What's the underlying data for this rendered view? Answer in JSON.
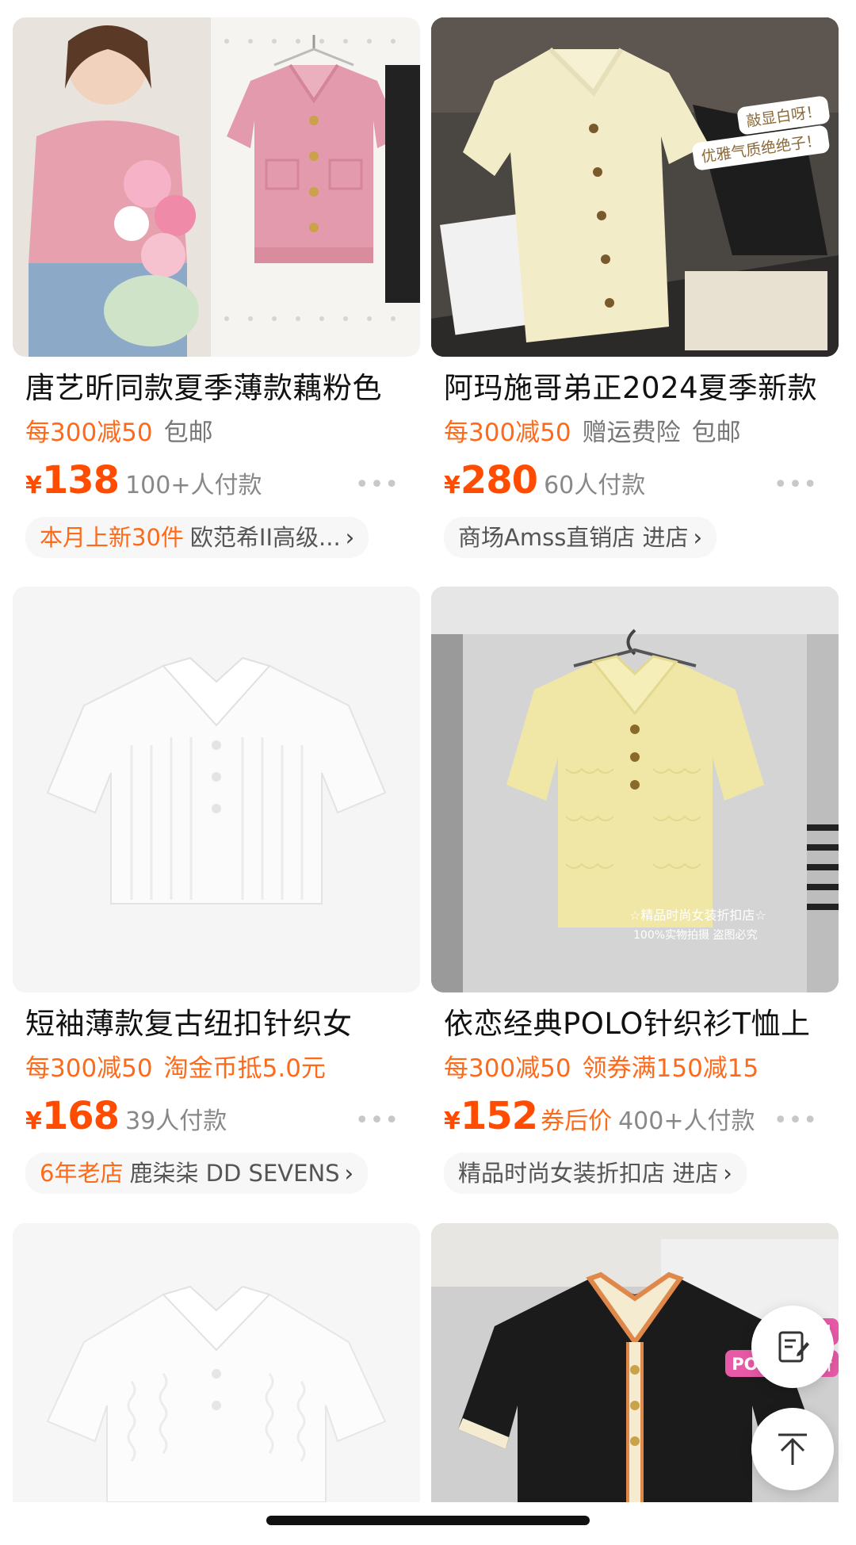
{
  "products": [
    {
      "title": "唐艺昕同款夏季薄款藕粉色",
      "promos": [
        {
          "text": "每300减50",
          "style": "orange"
        },
        {
          "text": "包邮",
          "style": "gray"
        }
      ],
      "currency": "¥",
      "price": "138",
      "price_suffix": "",
      "paid": "100+人付款",
      "shop_highlight": "本月上新30件",
      "shop_name": "欧范希II高级...",
      "shop_action": "",
      "image_icon": "pink-knit-polo-photo"
    },
    {
      "title": "阿玛施哥弟正2024夏季新款",
      "promos": [
        {
          "text": "每300减50",
          "style": "orange"
        },
        {
          "text": "赠运费险",
          "style": "gray"
        },
        {
          "text": "包邮",
          "style": "gray"
        }
      ],
      "currency": "¥",
      "price": "280",
      "price_suffix": "",
      "paid": "60人付款",
      "shop_highlight": "",
      "shop_name": "商场Amss直销店",
      "shop_action": "进店",
      "image_icon": "cream-knit-cardigan-photo",
      "sticker_lines": [
        "敲显白呀！",
        "优雅气质绝绝子！"
      ]
    },
    {
      "title": "短袖薄款复古纽扣针织女",
      "promos": [
        {
          "text": "每300减50",
          "style": "orange"
        },
        {
          "text": "淘金币抵5.0元",
          "style": "orange"
        }
      ],
      "currency": "¥",
      "price": "168",
      "price_suffix": "",
      "paid": "39人付款",
      "shop_highlight": "6年老店",
      "shop_name": "鹿柒柒 DD SEVENS",
      "shop_action": "",
      "image_icon": "white-ribbed-polo-photo"
    },
    {
      "title": "依恋经典POLO针织衫T恤上",
      "promos": [
        {
          "text": "每300减50",
          "style": "orange"
        },
        {
          "text": "领券满150减15",
          "style": "orange"
        }
      ],
      "currency": "¥",
      "price": "152",
      "price_suffix": "券后价",
      "paid": "400+人付款",
      "shop_highlight": "",
      "shop_name": "精品时尚女装折扣店",
      "shop_action": "进店",
      "image_icon": "yellow-knit-polo-photo",
      "watermark": "☆精品时尚女装折扣店☆",
      "watermark2": "100%实物拍摄 盗图必究"
    },
    {
      "image_icon": "white-cable-knit-polo-photo"
    },
    {
      "image_icon": "black-knit-polo-photo",
      "tag_lines": [
        "夏日",
        "POLO小清新"
      ]
    }
  ],
  "more_glyph": "•••",
  "arrow_glyph": "›",
  "float_buttons": {
    "edit": "edit-icon",
    "top": "back-to-top-icon"
  }
}
